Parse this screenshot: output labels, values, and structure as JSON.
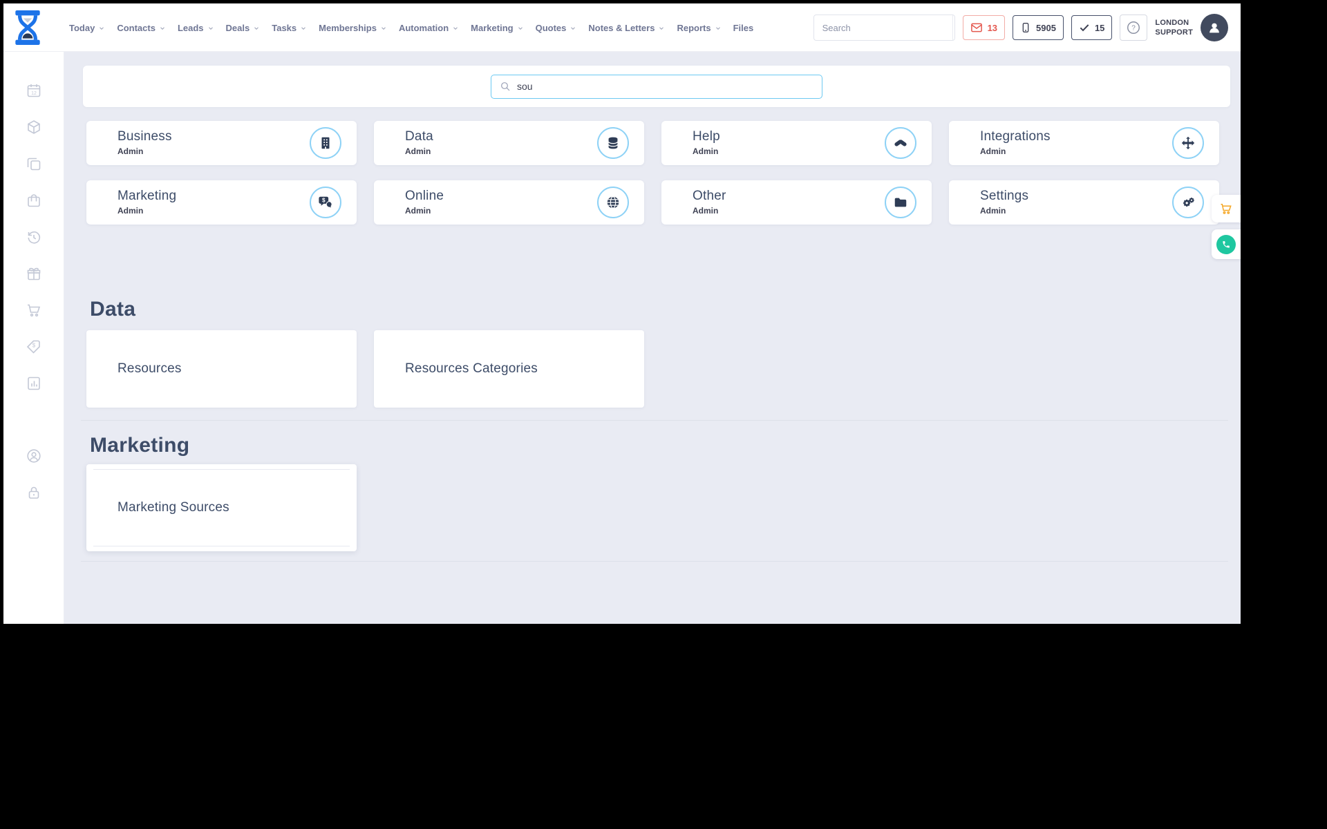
{
  "topnav": {
    "items": [
      "Today",
      "Contacts",
      "Leads",
      "Deals",
      "Tasks",
      "Memberships",
      "Automation",
      "Marketing",
      "Quotes",
      "Notes & Letters",
      "Reports",
      "Files"
    ],
    "search_placeholder": "Search",
    "badges": {
      "mail": "13",
      "phone": "5905",
      "tasks": "15"
    },
    "user": {
      "line1": "LONDON",
      "line2": "SUPPORT"
    }
  },
  "admin_search": {
    "value": "sou"
  },
  "category_cards": [
    {
      "title": "Business",
      "subtitle": "Admin",
      "icon": "building-icon"
    },
    {
      "title": "Data",
      "subtitle": "Admin",
      "icon": "database-icon"
    },
    {
      "title": "Help",
      "subtitle": "Admin",
      "icon": "handshake-icon"
    },
    {
      "title": "Integrations",
      "subtitle": "Admin",
      "icon": "move-arrows-icon"
    },
    {
      "title": "Marketing",
      "subtitle": "Admin",
      "icon": "chat-dollar-icon"
    },
    {
      "title": "Online",
      "subtitle": "Admin",
      "icon": "globe-icon"
    },
    {
      "title": "Other",
      "subtitle": "Admin",
      "icon": "folder-icon"
    },
    {
      "title": "Settings",
      "subtitle": "Admin",
      "icon": "gears-icon"
    }
  ],
  "sections": [
    {
      "heading": "Data",
      "cards": [
        {
          "label": "Resources"
        },
        {
          "label": "Resources Categories"
        }
      ]
    },
    {
      "heading": "Marketing",
      "cards": [
        {
          "label": "Marketing Sources"
        }
      ]
    }
  ],
  "sidebar": {
    "icons": [
      "calendar-icon",
      "cube-icon",
      "copy-icon",
      "shopping-bag-icon",
      "history-icon",
      "gift-icon",
      "cart-icon",
      "price-tag-icon",
      "bar-chart-icon",
      "user-circle-icon",
      "lock-icon"
    ]
  },
  "floating": {
    "cart": "shopping-cart-icon",
    "chat": "phone-icon"
  },
  "colors": {
    "accent_blue": "#1d73e8",
    "icon_navy": "#2e3c55",
    "circle_border": "#8ed2f6",
    "badge_red": "#e4574e",
    "whatsapp_green": "#1fc7a0",
    "cart_orange": "#f5a623",
    "text_dark": "#3f4254",
    "heading_text": "#3d4c68",
    "nav_text": "#6f7694",
    "content_bg": "#e9ebf3"
  }
}
